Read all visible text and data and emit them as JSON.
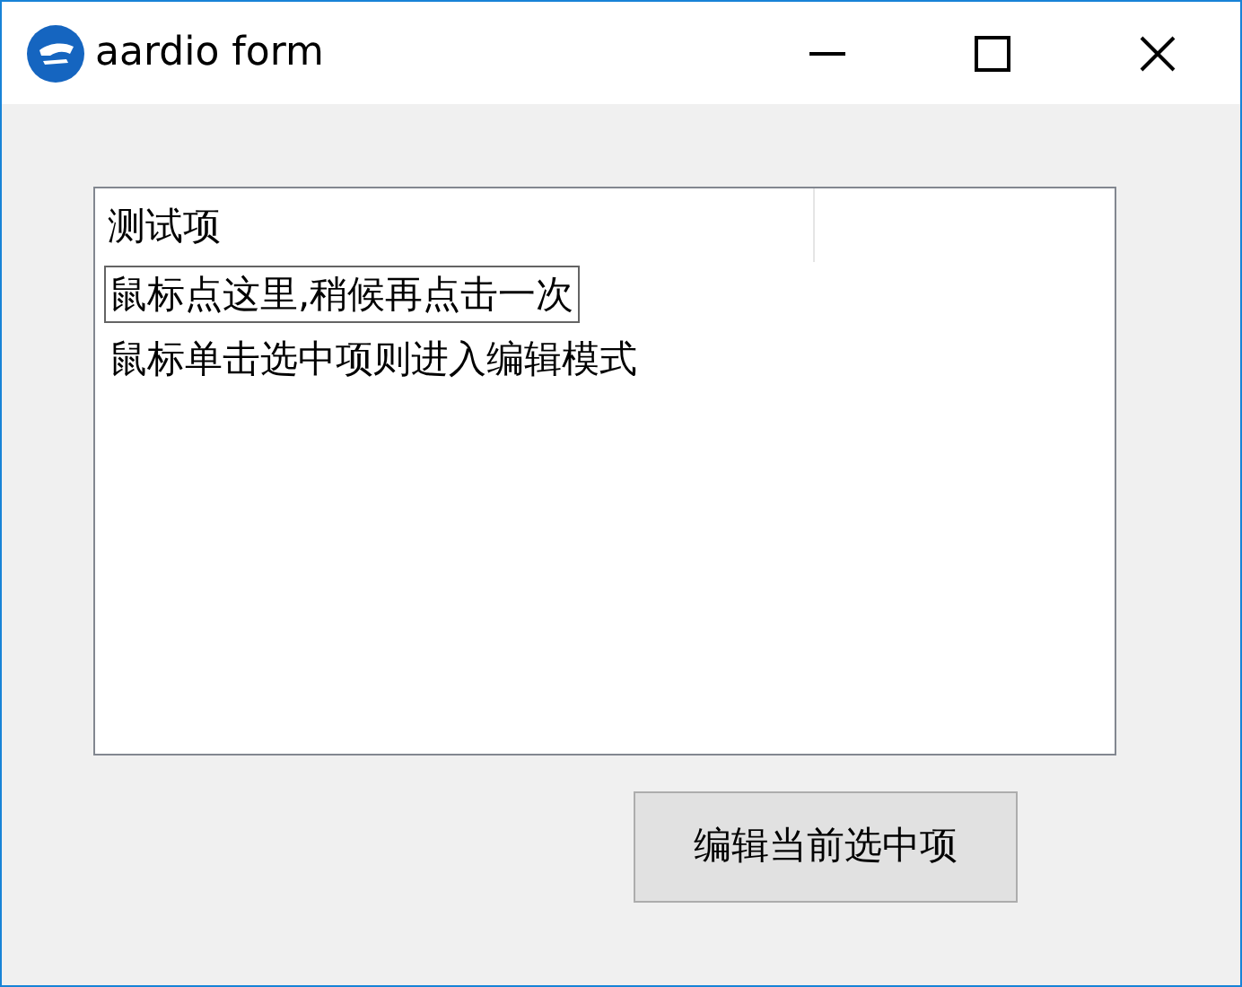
{
  "window": {
    "title": "aardio form"
  },
  "list": {
    "columns": [
      "测试项"
    ],
    "rows": [
      {
        "text": "鼠标点这里,稍候再点击一次",
        "focused": true
      },
      {
        "text": "鼠标单击选中项则进入编辑模式",
        "focused": false
      }
    ]
  },
  "buttons": [
    "编辑当前选中项"
  ]
}
